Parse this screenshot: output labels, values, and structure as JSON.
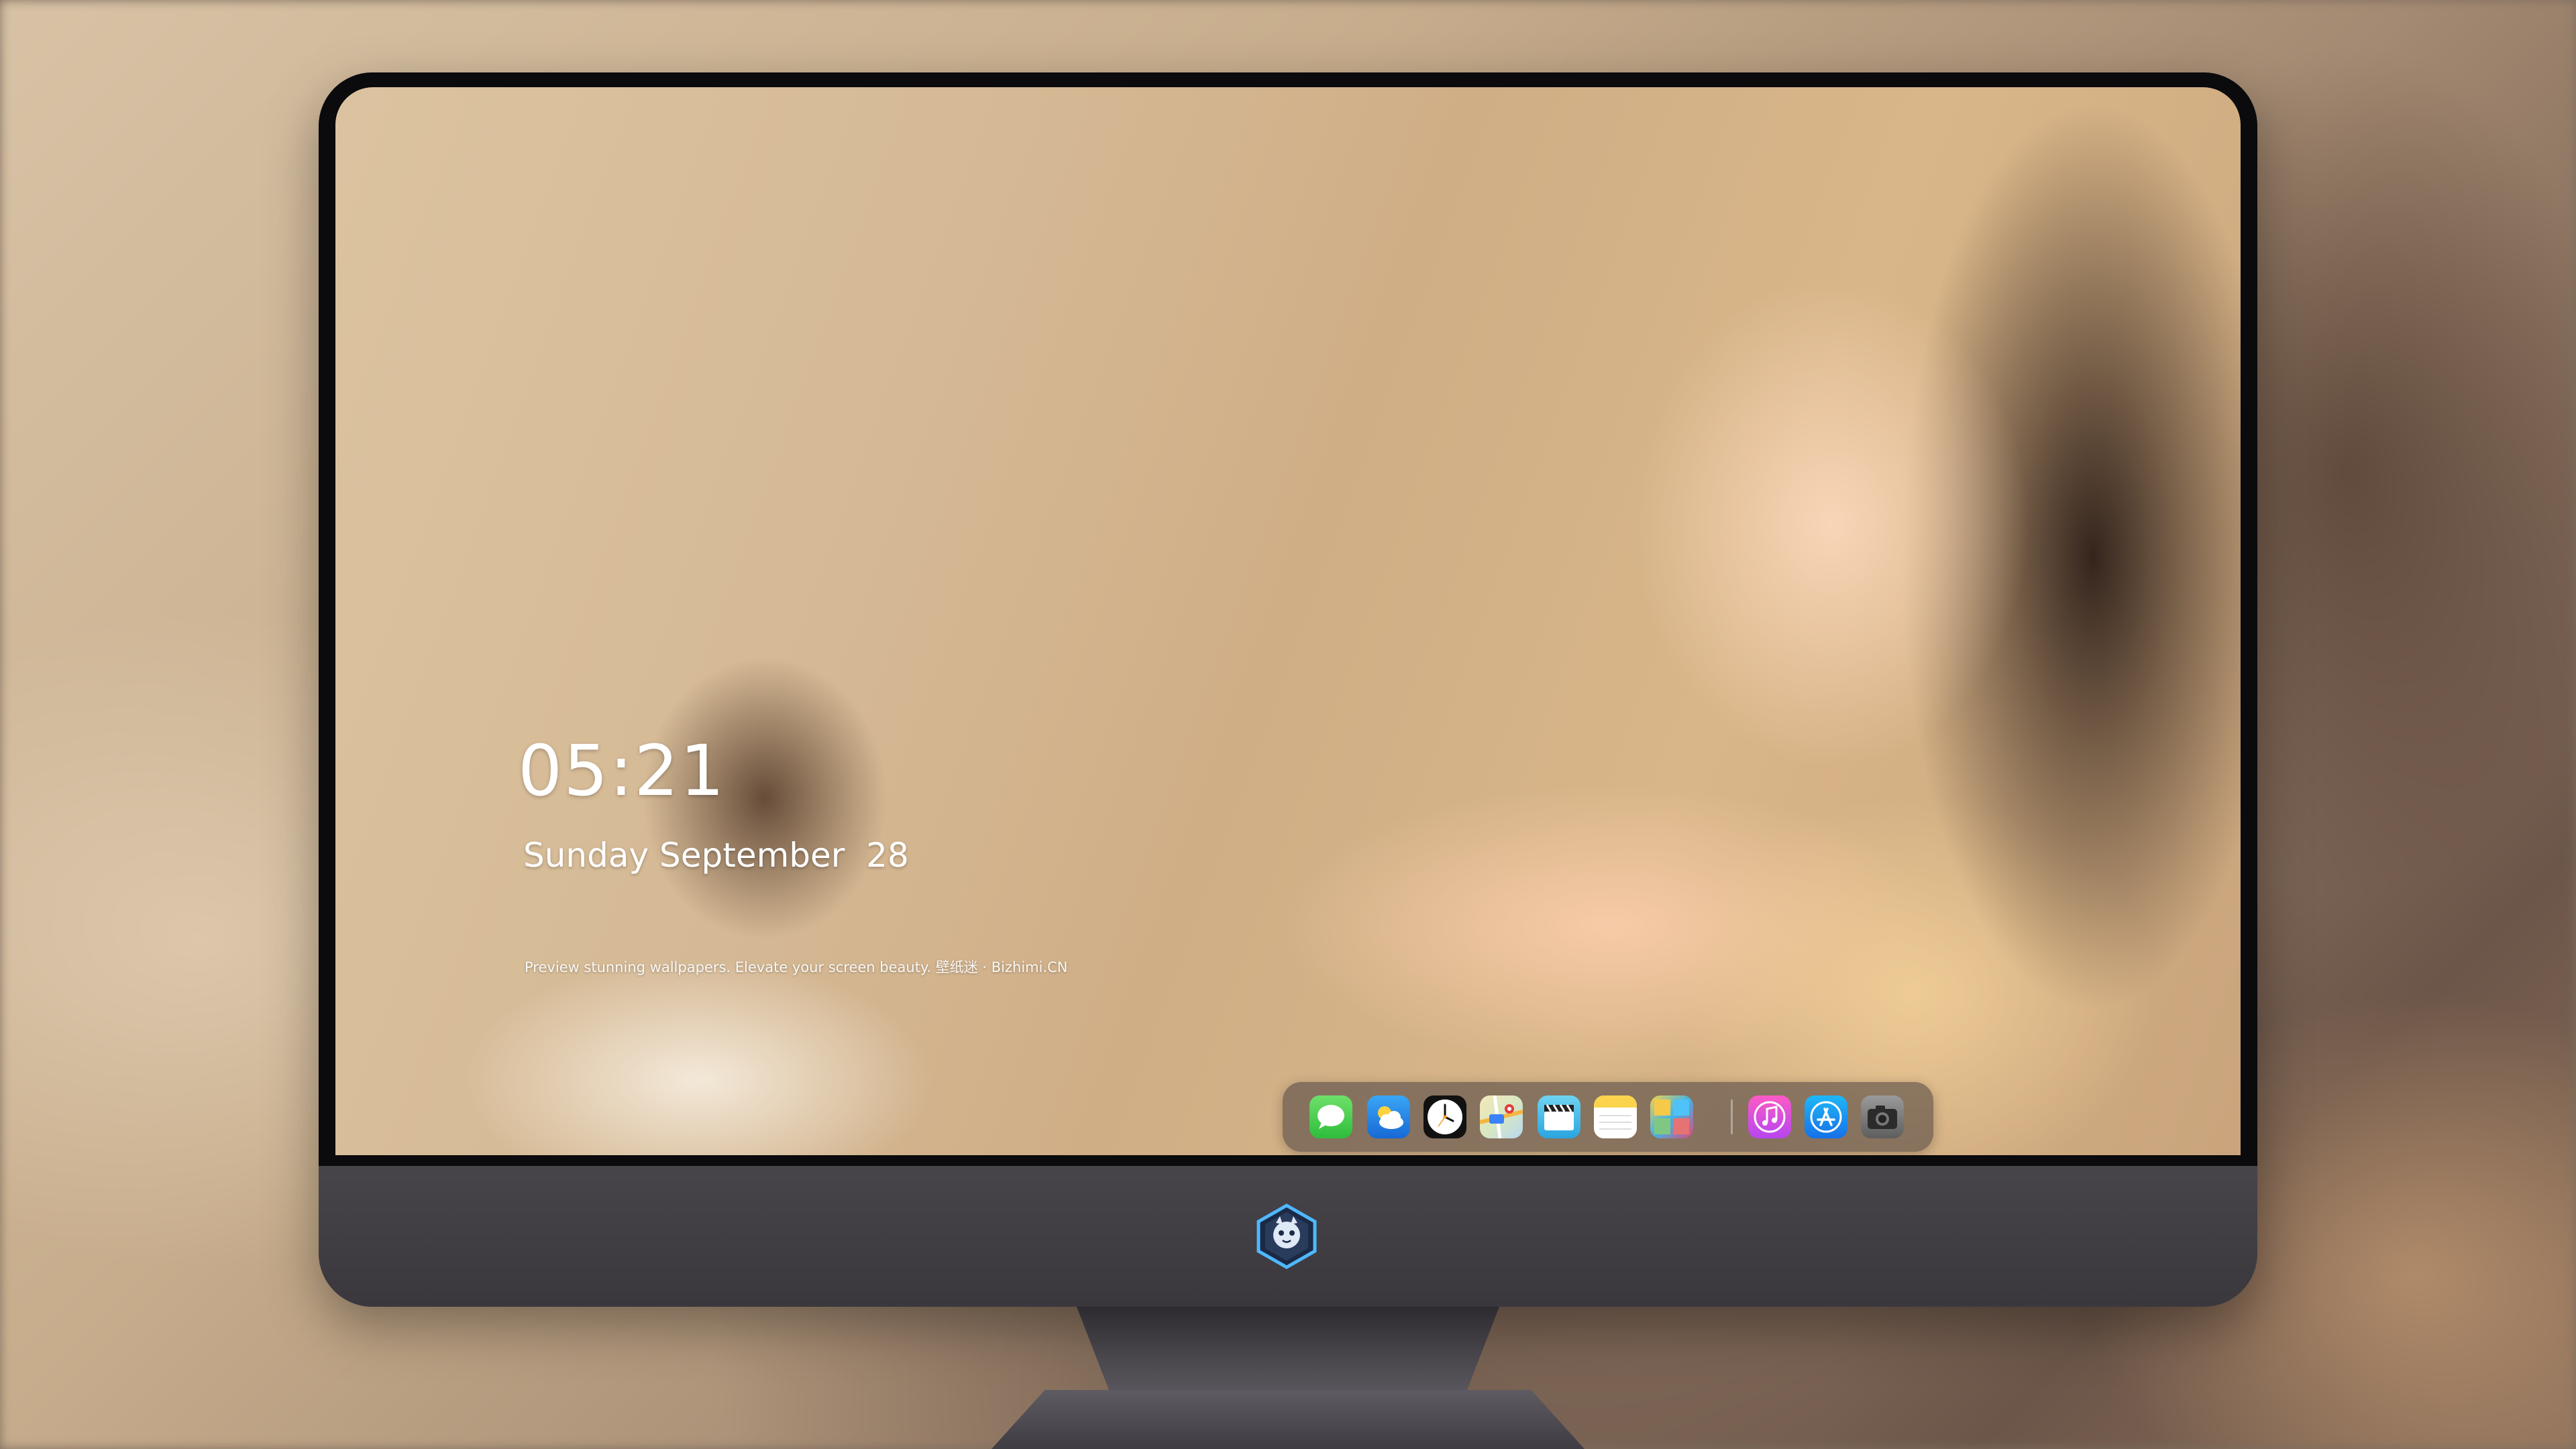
{
  "lock_screen": {
    "time": "05:21",
    "date": "Sunday September  28",
    "tagline": "Preview stunning wallpapers. Elevate your screen beauty. 壁纸迷 · Bizhimi.CN"
  },
  "dock": {
    "apps": [
      {
        "name": "Messages",
        "icon": "messages-icon"
      },
      {
        "name": "Weather",
        "icon": "weather-icon"
      },
      {
        "name": "Clock",
        "icon": "clock-icon"
      },
      {
        "name": "Maps",
        "icon": "maps-icon"
      },
      {
        "name": "Clips",
        "icon": "clips-icon"
      },
      {
        "name": "Notes",
        "icon": "notes-icon"
      },
      {
        "name": "Photo Booth",
        "icon": "photo-booth-icon"
      },
      {
        "name": "Music",
        "icon": "music-icon"
      },
      {
        "name": "App Store",
        "icon": "app-store-icon"
      },
      {
        "name": "Camera",
        "icon": "camera-icon"
      }
    ]
  },
  "monitor": {
    "logo": "dragon-mascot-logo"
  },
  "colors": {
    "bezel": "#0b0a0c",
    "chin": "#3c3a3f",
    "clock_text": "#ffffff"
  }
}
